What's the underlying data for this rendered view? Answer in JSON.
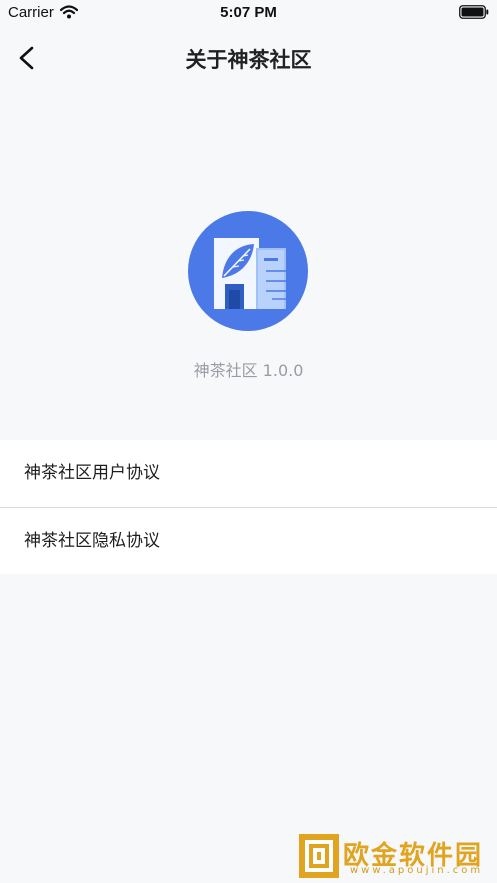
{
  "status_bar": {
    "carrier": "Carrier",
    "time": "5:07 PM"
  },
  "nav": {
    "title": "关于神茶社区"
  },
  "app": {
    "version_text": "神茶社区 1.0.0"
  },
  "menu": {
    "items": [
      {
        "label": "神茶社区用户协议"
      },
      {
        "label": "神茶社区隐私协议"
      }
    ]
  },
  "watermark": {
    "text": "欧金软件园",
    "sub": "www.apoujin.com"
  },
  "colors": {
    "background": "#f7f8fa",
    "logo_circle": "#4b79e8",
    "watermark": "#e0a421"
  }
}
